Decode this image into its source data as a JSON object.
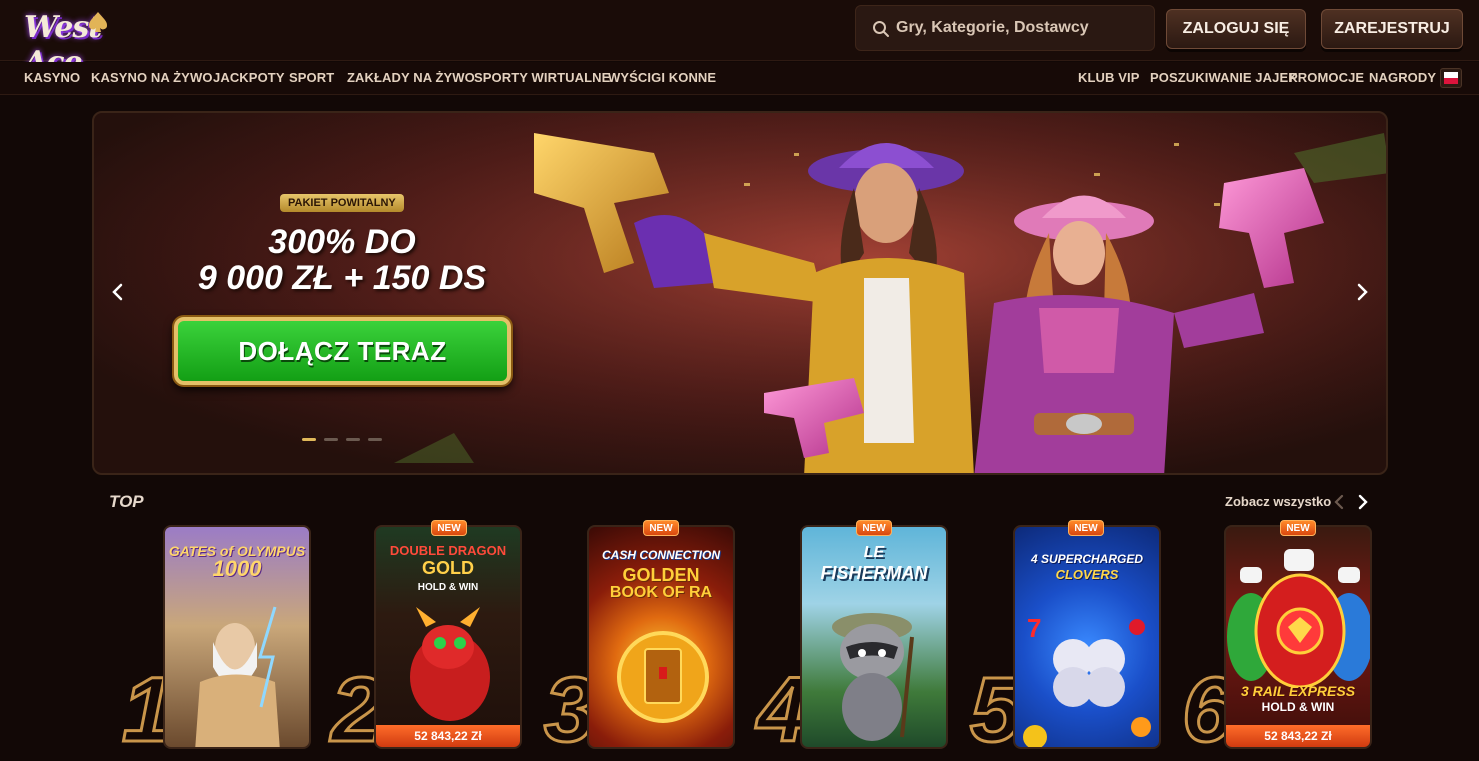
{
  "header": {
    "logo_text": "West Ace",
    "search_placeholder": "Gry, Kategorie, Dostawcy",
    "login_label": "ZALOGUJ SIĘ",
    "register_label": "ZAREJESTRUJ"
  },
  "nav": {
    "left": [
      "KASYNO",
      "KASYNO NA ŻYWO",
      "JACKPOTY",
      "SPORT",
      "ZAKŁADY NA ŻYWO",
      "SPORTY WIRTUALNE",
      "WYŚCIGI KONNE"
    ],
    "right": [
      "KLUB VIP",
      "POSZUKIWANIE JAJEK",
      "PROMOCJE",
      "NAGRODY"
    ],
    "language_flag": "pl-flag-icon"
  },
  "hero": {
    "badge": "PAKIET POWITALNY",
    "title_line1": "300% DO",
    "title_line2": "9 000 ZŁ + 150 DS",
    "cta_label": "DOŁĄCZ TERAZ",
    "slide_count": 4,
    "active_slide": 1
  },
  "top_section": {
    "title": "TOP",
    "see_all_label": "Zobacz wszystko",
    "new_label": "NEW",
    "games": [
      {
        "rank": "1",
        "title_line1": "GATES of OLYMPUS",
        "title_line2": "1000",
        "is_new": false,
        "jackpot": ""
      },
      {
        "rank": "2",
        "title_line1": "DOUBLE DRAGON",
        "title_line2": "GOLD",
        "title_line3": "HOLD & WIN",
        "is_new": true,
        "jackpot": "52 843,22 Zł"
      },
      {
        "rank": "3",
        "title_line1": "CASH CONNECTION",
        "title_line2": "GOLDEN",
        "title_line3": "BOOK OF RA",
        "is_new": true,
        "jackpot": ""
      },
      {
        "rank": "4",
        "title_line1": "LE",
        "title_line2": "FISHERMAN",
        "is_new": true,
        "jackpot": ""
      },
      {
        "rank": "5",
        "title_line1": "4 SUPERCHARGED",
        "title_line2": "CLOVERS",
        "is_new": true,
        "jackpot": ""
      },
      {
        "rank": "6",
        "title_line1": "3 RAIL EXPRESS",
        "title_line2": "HOLD & WIN",
        "is_new": true,
        "jackpot": "52 843,22 Zł"
      }
    ]
  },
  "colors": {
    "background": "#120806",
    "accent_gold": "#c9954a",
    "cta_green": "#22b822",
    "new_badge": "#e8591a"
  }
}
